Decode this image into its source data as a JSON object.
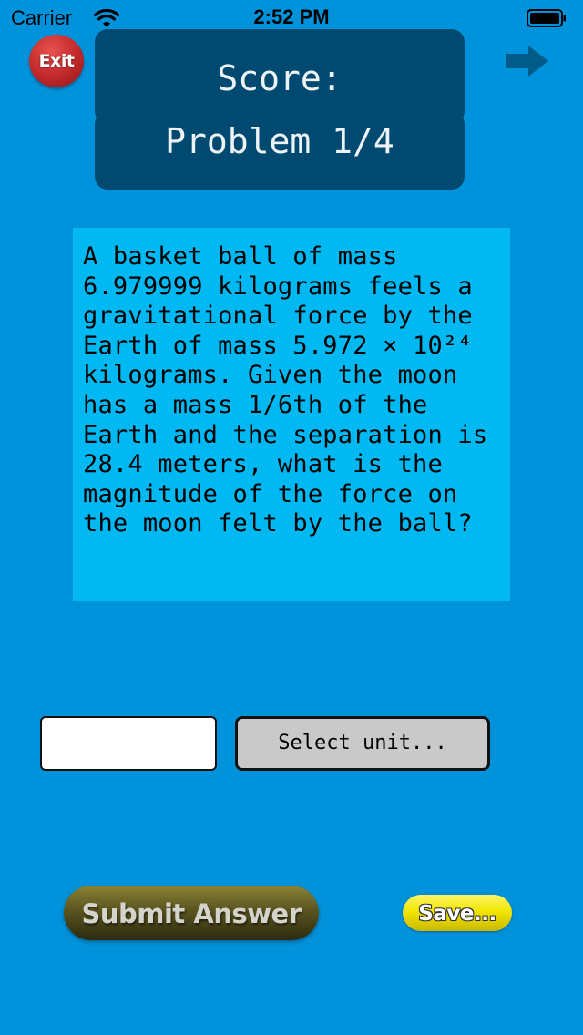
{
  "status_bar": {
    "carrier": "Carrier",
    "time": "2:52 PM",
    "wifi_icon": "wifi-icon",
    "battery_icon": "battery-icon"
  },
  "header": {
    "exit_label": "Exit",
    "next_icon": "arrow-right-icon",
    "score_label": "Score:",
    "problem_label": "Problem 1/4"
  },
  "question": {
    "text": "A basket ball of mass\n6.979999 kilograms feels a\ngravitational force by the\nEarth of mass 5.972 × 10²⁴\nkilograms. Given the moon\nhas a mass 1/6th of the\nEarth and the separation is\n28.4 meters, what is the\nmagnitude of the force on\nthe moon felt by the ball?"
  },
  "answer": {
    "value": "",
    "placeholder": "",
    "unit_label": "Select unit..."
  },
  "actions": {
    "submit_label": "Submit Answer",
    "save_label": "Save..."
  },
  "colors": {
    "background": "#0093dc",
    "panel": "#004a72",
    "question_box": "#00b9f2",
    "exit": "#c0282a",
    "save": "#f2e600"
  }
}
